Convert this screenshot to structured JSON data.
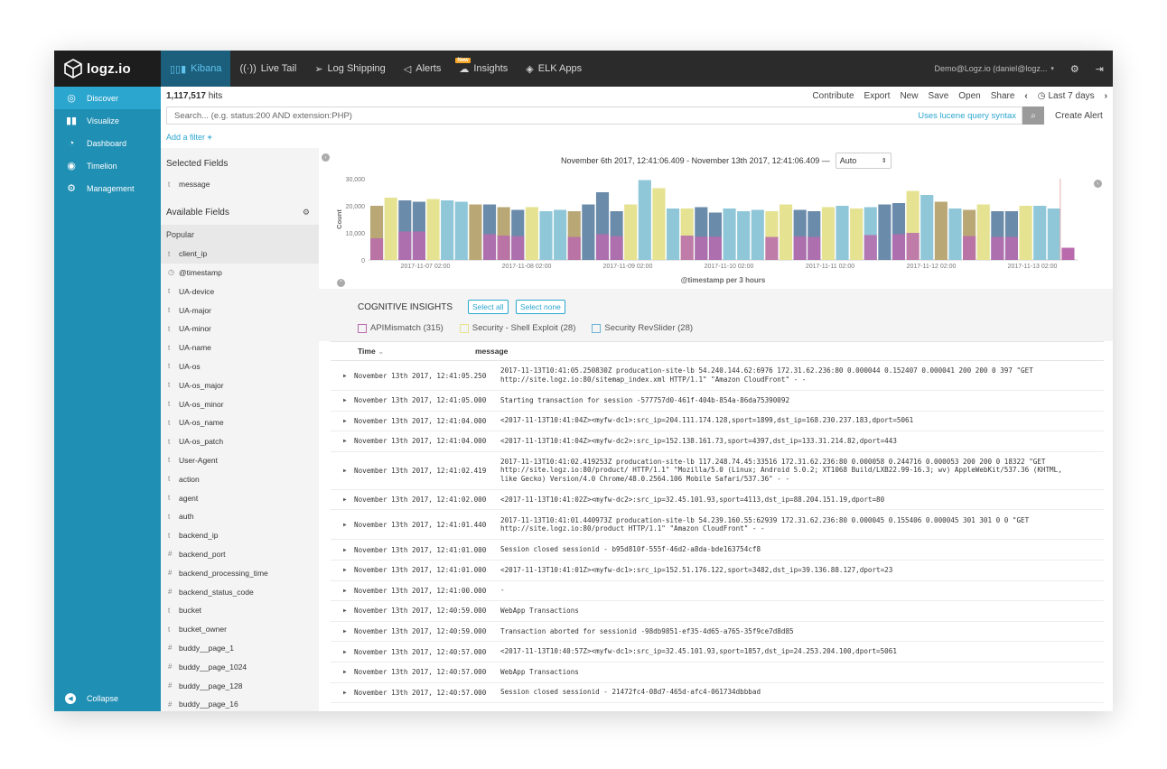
{
  "topbar": {
    "brand": "logz.io",
    "nav": [
      {
        "label": "Kibana",
        "icon": "bar-chart-icon",
        "active": true
      },
      {
        "label": "Live Tail",
        "icon": "live-tail-icon"
      },
      {
        "label": "Log Shipping",
        "icon": "paper-plane-icon"
      },
      {
        "label": "Alerts",
        "icon": "megaphone-icon"
      },
      {
        "label": "Insights",
        "icon": "insights-icon",
        "badge": "New"
      },
      {
        "label": "ELK Apps",
        "icon": "layers-icon"
      }
    ],
    "user": "Demo@Logz.io (daniel@logz...",
    "settings_icon": "gear-icon",
    "logout_icon": "logout-icon"
  },
  "sidebar": {
    "items": [
      {
        "label": "Discover",
        "icon": "compass-icon",
        "active": true
      },
      {
        "label": "Visualize",
        "icon": "visualize-icon"
      },
      {
        "label": "Dashboard",
        "icon": "dashboard-icon"
      },
      {
        "label": "Timelion",
        "icon": "timelion-icon"
      },
      {
        "label": "Management",
        "icon": "gear-icon"
      }
    ],
    "collapse": "Collapse"
  },
  "toolbar": {
    "hits_count": "1,117,517",
    "hits_label": "hits",
    "actions": [
      "Contribute",
      "Export",
      "New",
      "Save",
      "Open",
      "Share"
    ],
    "time_range": "Last 7 days"
  },
  "search": {
    "placeholder": "Search... (e.g. status:200 AND extension:PHP)",
    "lucene_link": "Uses lucene query syntax",
    "create_alert": "Create Alert"
  },
  "add_filter": "Add a filter",
  "fields": {
    "selected_title": "Selected Fields",
    "selected": [
      {
        "type": "t",
        "name": "message"
      }
    ],
    "available_title": "Available Fields",
    "popular_label": "Popular",
    "available": [
      {
        "type": "t",
        "name": "client_ip"
      },
      {
        "type": "◷",
        "name": "@timestamp"
      },
      {
        "type": "t",
        "name": "UA-device"
      },
      {
        "type": "t",
        "name": "UA-major"
      },
      {
        "type": "t",
        "name": "UA-minor"
      },
      {
        "type": "t",
        "name": "UA-name"
      },
      {
        "type": "t",
        "name": "UA-os"
      },
      {
        "type": "t",
        "name": "UA-os_major"
      },
      {
        "type": "t",
        "name": "UA-os_minor"
      },
      {
        "type": "t",
        "name": "UA-os_name"
      },
      {
        "type": "t",
        "name": "UA-os_patch"
      },
      {
        "type": "t",
        "name": "User-Agent"
      },
      {
        "type": "t",
        "name": "action"
      },
      {
        "type": "t",
        "name": "agent"
      },
      {
        "type": "t",
        "name": "auth"
      },
      {
        "type": "t",
        "name": "backend_ip"
      },
      {
        "type": "#",
        "name": "backend_port"
      },
      {
        "type": "#",
        "name": "backend_processing_time"
      },
      {
        "type": "#",
        "name": "backend_status_code"
      },
      {
        "type": "t",
        "name": "bucket"
      },
      {
        "type": "t",
        "name": "bucket_owner"
      },
      {
        "type": "#",
        "name": "buddy__page_1"
      },
      {
        "type": "#",
        "name": "buddy__page_1024"
      },
      {
        "type": "#",
        "name": "buddy__page_128"
      },
      {
        "type": "#",
        "name": "buddy__page_16"
      }
    ]
  },
  "histogram": {
    "range_text": "November 6th 2017, 12:41:06.409 - November 13th 2017, 12:41:06.409 —",
    "interval": "Auto"
  },
  "chart_data": {
    "type": "bar",
    "title": "",
    "xlabel": "@timestamp per 3 hours",
    "ylabel": "Count",
    "ylim": [
      0,
      30000
    ],
    "yticks": [
      "30,000",
      "20,000",
      "10,000",
      "0"
    ],
    "xticks": [
      "2017-11-07 02:00",
      "2017-11-08 02:00",
      "2017-11-09 02:00",
      "2017-11-10 02:00",
      "2017-11-11 02:00",
      "2017-11-12 02:00",
      "2017-11-13 02:00"
    ],
    "colors": {
      "olive": "#b9a876",
      "yellow": "#e5e291",
      "blue": "#6b8bab",
      "teal": "#8fc7d9",
      "purple": "#b86aad",
      "marker": "#e8b0b0"
    },
    "bars": [
      {
        "total": 20000,
        "color": "olive",
        "purple": 8000
      },
      {
        "total": 23000,
        "color": "yellow",
        "purple": 0
      },
      {
        "total": 22000,
        "color": "blue",
        "purple": 10500
      },
      {
        "total": 21500,
        "color": "blue",
        "purple": 10500
      },
      {
        "total": 22500,
        "color": "yellow",
        "purple": 0
      },
      {
        "total": 22000,
        "color": "teal",
        "purple": 0
      },
      {
        "total": 21500,
        "color": "teal",
        "purple": 0
      },
      {
        "total": 20500,
        "color": "olive",
        "purple": 0
      },
      {
        "total": 20500,
        "color": "blue",
        "purple": 9500
      },
      {
        "total": 19500,
        "color": "olive",
        "purple": 9000
      },
      {
        "total": 18500,
        "color": "blue",
        "purple": 8800
      },
      {
        "total": 19500,
        "color": "yellow",
        "purple": 0
      },
      {
        "total": 18000,
        "color": "teal",
        "purple": 0
      },
      {
        "total": 18500,
        "color": "teal",
        "purple": 0
      },
      {
        "total": 18000,
        "color": "olive",
        "purple": 8500
      },
      {
        "total": 20500,
        "color": "blue",
        "purple": 0
      },
      {
        "total": 25000,
        "color": "blue",
        "purple": 9500
      },
      {
        "total": 18000,
        "color": "blue",
        "purple": 8800
      },
      {
        "total": 20500,
        "color": "yellow",
        "purple": 0
      },
      {
        "total": 29500,
        "color": "teal",
        "purple": 0
      },
      {
        "total": 26500,
        "color": "yellow",
        "purple": 0
      },
      {
        "total": 19000,
        "color": "teal",
        "purple": 0
      },
      {
        "total": 19000,
        "color": "yellow",
        "purple": 9000
      },
      {
        "total": 19500,
        "color": "blue",
        "purple": 8600
      },
      {
        "total": 17500,
        "color": "blue",
        "purple": 8600
      },
      {
        "total": 19000,
        "color": "teal",
        "purple": 0
      },
      {
        "total": 18000,
        "color": "teal",
        "purple": 0
      },
      {
        "total": 18500,
        "color": "teal",
        "purple": 0
      },
      {
        "total": 18000,
        "color": "yellow",
        "purple": 8500
      },
      {
        "total": 20500,
        "color": "yellow",
        "purple": 0
      },
      {
        "total": 18500,
        "color": "blue",
        "purple": 8700
      },
      {
        "total": 18000,
        "color": "blue",
        "purple": 8500
      },
      {
        "total": 19500,
        "color": "yellow",
        "purple": 0
      },
      {
        "total": 20000,
        "color": "teal",
        "purple": 0
      },
      {
        "total": 19000,
        "color": "yellow",
        "purple": 0
      },
      {
        "total": 19500,
        "color": "teal",
        "purple": 9200
      },
      {
        "total": 20500,
        "color": "blue",
        "purple": 0
      },
      {
        "total": 21000,
        "color": "blue",
        "purple": 9500
      },
      {
        "total": 25500,
        "color": "yellow",
        "purple": 10000
      },
      {
        "total": 24000,
        "color": "teal",
        "purple": 0
      },
      {
        "total": 21500,
        "color": "olive",
        "purple": 0
      },
      {
        "total": 19000,
        "color": "teal",
        "purple": 0
      },
      {
        "total": 18500,
        "color": "olive",
        "purple": 8800
      },
      {
        "total": 20500,
        "color": "yellow",
        "purple": 0
      },
      {
        "total": 18000,
        "color": "blue",
        "purple": 8500
      },
      {
        "total": 18000,
        "color": "blue",
        "purple": 8500
      },
      {
        "total": 20000,
        "color": "yellow",
        "purple": 0
      },
      {
        "total": 20000,
        "color": "teal",
        "purple": 0
      },
      {
        "total": 19000,
        "color": "teal",
        "purple": 0
      },
      {
        "total": 4500,
        "color": "purple",
        "purple": 4500
      }
    ]
  },
  "insights": {
    "title": "COGNITIVE INSIGHTS",
    "select_all": "Select all",
    "select_none": "Select none",
    "legend": [
      {
        "label": "APIMismatch (315)",
        "color": "#b86aad"
      },
      {
        "label": "Security - Shell Exploit (28)",
        "color": "#e5e291"
      },
      {
        "label": "Security RevSlider (28)",
        "color": "#6bb5d4"
      }
    ]
  },
  "table": {
    "col_time": "Time",
    "col_message": "message",
    "rows": [
      {
        "time": "November 13th 2017, 12:41:05.250",
        "message": "2017-11-13T10:41:05.250830Z producation-site-lb 54.240.144.62:6976 172.31.62.236:80 0.000044 0.152407 0.000041 200 200 0 397 \"GET http://site.logz.io:80/sitemap_index.xml HTTP/1.1\" \"Amazon CloudFront\" - -"
      },
      {
        "time": "November 13th 2017, 12:41:05.000",
        "message": "Starting transaction for session -577757d0-461f-404b-854a-86da75390092"
      },
      {
        "time": "November 13th 2017, 12:41:04.000",
        "message": "<2017-11-13T10:41:04Z><myfw-dc1>:src_ip=204.111.174.128,sport=1899,dst_ip=168.230.237.183,dport=5061"
      },
      {
        "time": "November 13th 2017, 12:41:04.000",
        "message": "<2017-11-13T10:41:04Z><myfw-dc2>:src_ip=152.138.161.73,sport=4397,dst_ip=133.31.214.82,dport=443"
      },
      {
        "time": "November 13th 2017, 12:41:02.419",
        "message": "2017-11-13T10:41:02.419253Z producation-site-lb 117.248.74.45:33516 172.31.62.236:80 0.000058 0.244716 0.000053 200 200 0 18322 \"GET http://site.logz.io:80/product/ HTTP/1.1\" \"Mozilla/5.0 (Linux; Android 5.0.2; XT1068 Build/LXB22.99-16.3; wv) AppleWebKit/537.36 (KHTML, like Gecko) Version/4.0 Chrome/48.0.2564.106 Mobile Safari/537.36\" - -"
      },
      {
        "time": "November 13th 2017, 12:41:02.000",
        "message": "<2017-11-13T10:41:02Z><myfw-dc2>:src_ip=32.45.101.93,sport=4113,dst_ip=88.204.151.19,dport=80"
      },
      {
        "time": "November 13th 2017, 12:41:01.440",
        "message": "2017-11-13T10:41:01.440973Z producation-site-lb 54.239.160.55:62939 172.31.62.236:80 0.000045 0.155406 0.000045 301 301 0 0 \"GET http://site.logz.io:80/product HTTP/1.1\" \"Amazon CloudFront\" - -"
      },
      {
        "time": "November 13th 2017, 12:41:01.000",
        "message": "Session closed sessionid - b95d810f-555f-46d2-a8da-bde163754cf8"
      },
      {
        "time": "November 13th 2017, 12:41:01.000",
        "message": "<2017-11-13T10:41:01Z><myfw-dc1>:src_ip=152.51.176.122,sport=3482,dst_ip=39.136.88.127,dport=23"
      },
      {
        "time": "November 13th 2017, 12:41:00.000",
        "message": " -"
      },
      {
        "time": "November 13th 2017, 12:40:59.000",
        "message": "WebApp Transactions"
      },
      {
        "time": "November 13th 2017, 12:40:59.000",
        "message": "Transaction aborted for sessionid -98db9851-ef35-4d65-a765-35f9ce7d8d85"
      },
      {
        "time": "November 13th 2017, 12:40:57.000",
        "message": "<2017-11-13T10:40:57Z><myfw-dc1>:src_ip=32.45.101.93,sport=1857,dst_ip=24.253.204.100,dport=5061"
      },
      {
        "time": "November 13th 2017, 12:40:57.000",
        "message": "WebApp Transactions"
      },
      {
        "time": "November 13th 2017, 12:40:57.000",
        "message": "Session closed sessionid - 21472fc4-08d7-465d-afc4-061734dbbbad"
      }
    ]
  }
}
